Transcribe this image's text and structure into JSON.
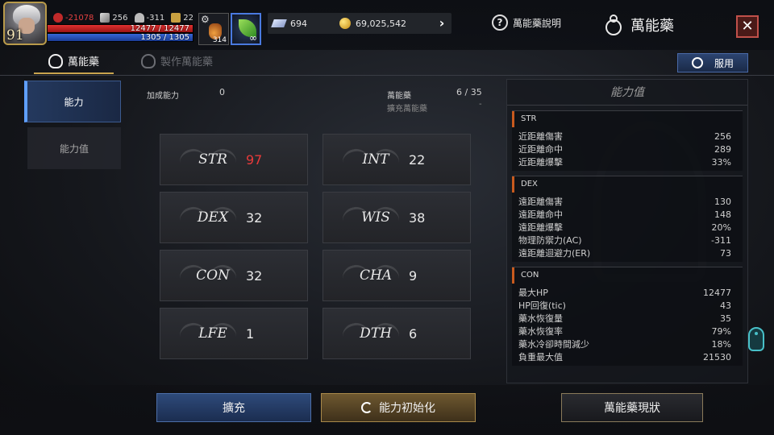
{
  "player": {
    "level": "91",
    "stat_red": "-21078",
    "stat_sword": "256",
    "stat_helmet": "-311",
    "stat_trophy": "22",
    "hp": "12477 / 12477",
    "mp": "1305 / 1305"
  },
  "slots": {
    "potion_count": "314",
    "buff_duration": "∞"
  },
  "currency": {
    "crystals": "694",
    "gold": "69,025,542"
  },
  "header": {
    "help_label": "萬能藥說明",
    "title": "萬能藥",
    "close_label": "✕"
  },
  "tabs": [
    {
      "label": "萬能藥"
    },
    {
      "label": "製作萬能藥"
    }
  ],
  "use_button": "服用",
  "sidenav": [
    {
      "label": "能力"
    },
    {
      "label": "能力值"
    }
  ],
  "info": {
    "bonus_label": "加成能力",
    "bonus_value": "0",
    "elixir_label": "萬能藥",
    "elixir_value": "6 / 35",
    "expand_label": "擴充萬能藥",
    "expand_value": "-"
  },
  "stats": [
    {
      "name": "STR",
      "value": "97"
    },
    {
      "name": "INT",
      "value": "22"
    },
    {
      "name": "DEX",
      "value": "32"
    },
    {
      "name": "WIS",
      "value": "38"
    },
    {
      "name": "CON",
      "value": "32"
    },
    {
      "name": "CHA",
      "value": "9"
    },
    {
      "name": "LFE",
      "value": "1"
    },
    {
      "name": "DTH",
      "value": "6"
    }
  ],
  "panel": {
    "title": "能力值",
    "groups": [
      {
        "name": "STR",
        "rows": [
          {
            "label": "近距離傷害",
            "value": "256"
          },
          {
            "label": "近距離命中",
            "value": "289"
          },
          {
            "label": "近距離爆擊",
            "value": "33%"
          }
        ]
      },
      {
        "name": "DEX",
        "rows": [
          {
            "label": "遠距離傷害",
            "value": "130"
          },
          {
            "label": "遠距離命中",
            "value": "148"
          },
          {
            "label": "遠距離爆擊",
            "value": "20%"
          },
          {
            "label": "物理防禦力(AC)",
            "value": "-311"
          },
          {
            "label": "遠距離迴避力(ER)",
            "value": "73"
          }
        ]
      },
      {
        "name": "CON",
        "rows": [
          {
            "label": "最大HP",
            "value": "12477"
          },
          {
            "label": "HP回復(tic)",
            "value": "43"
          },
          {
            "label": "藥水恢復量",
            "value": "35"
          },
          {
            "label": "藥水恢復率",
            "value": "79%"
          },
          {
            "label": "藥水冷卻時間減少",
            "value": "18%"
          },
          {
            "label": "負重最大值",
            "value": "21530"
          }
        ]
      }
    ]
  },
  "buttons": {
    "expand": "擴充",
    "reset": "能力初始化",
    "status": "萬能藥現狀"
  },
  "colors": {
    "accent_gold": "#c9a44e",
    "highlight_red": "#e83a3a",
    "nav_blue": "#5fa0ff",
    "group_marker": "#c85a1e"
  }
}
